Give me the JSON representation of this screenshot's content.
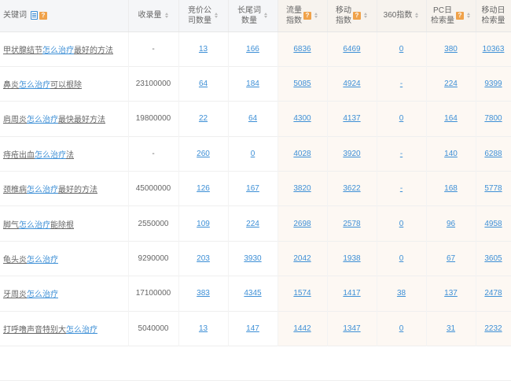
{
  "columns": {
    "keyword": "关键词",
    "indexed": "收录量",
    "bid_line1": "竞价公",
    "bid_line2": "司数量",
    "longtail_line1": "长尾词",
    "longtail_line2": "数量",
    "traffic_line1": "流量",
    "traffic_line2": "指数",
    "mobile_line1": "移动",
    "mobile_line2": "指数",
    "idx360": "360指数",
    "pc_line1": "PC日",
    "pc_line2": "检索量",
    "mob_line1": "移动日",
    "mob_line2": "检索量",
    "help_glyph": "?"
  },
  "rows": [
    {
      "pre": "甲状腺结节",
      "hl": "怎么治疗",
      "post": "最好的方法",
      "indexed": "-",
      "bid": "13",
      "longtail": "166",
      "traffic": "6836",
      "mobile": "6469",
      "idx360": "0",
      "pc": "380",
      "mob": "10363"
    },
    {
      "pre": "鼻炎",
      "hl": "怎么治疗",
      "post": "可以根除",
      "indexed": "23100000",
      "bid": "64",
      "longtail": "184",
      "traffic": "5085",
      "mobile": "4924",
      "idx360": "-",
      "pc": "224",
      "mob": "9399"
    },
    {
      "pre": "肩周炎",
      "hl": "怎么治疗",
      "post": "最快最好方法",
      "indexed": "19800000",
      "bid": "22",
      "longtail": "64",
      "traffic": "4300",
      "mobile": "4137",
      "idx360": "0",
      "pc": "164",
      "mob": "7800"
    },
    {
      "pre": "痔疮出血",
      "hl": "怎么治疗",
      "post": "法",
      "indexed": "-",
      "bid": "260",
      "longtail": "0",
      "traffic": "4028",
      "mobile": "3920",
      "idx360": "-",
      "pc": "140",
      "mob": "6288"
    },
    {
      "pre": "颈椎病",
      "hl": "怎么治疗",
      "post": "最好的方法",
      "indexed": "45000000",
      "bid": "126",
      "longtail": "167",
      "traffic": "3820",
      "mobile": "3622",
      "idx360": "-",
      "pc": "168",
      "mob": "5778"
    },
    {
      "pre": "脚气",
      "hl": "怎么治疗",
      "post": "能除根",
      "indexed": "2550000",
      "bid": "109",
      "longtail": "224",
      "traffic": "2698",
      "mobile": "2578",
      "idx360": "0",
      "pc": "96",
      "mob": "4958"
    },
    {
      "pre": "龟头炎",
      "hl": "怎么治疗",
      "post": "",
      "indexed": "9290000",
      "bid": "203",
      "longtail": "3930",
      "traffic": "2042",
      "mobile": "1938",
      "idx360": "0",
      "pc": "67",
      "mob": "3605"
    },
    {
      "pre": "牙周炎",
      "hl": "怎么治疗",
      "post": "",
      "indexed": "17100000",
      "bid": "383",
      "longtail": "4345",
      "traffic": "1574",
      "mobile": "1417",
      "idx360": "38",
      "pc": "137",
      "mob": "2478"
    },
    {
      "pre": "打呼噜声音特别大",
      "hl": "怎么治疗",
      "post": "",
      "indexed": "5040000",
      "bid": "13",
      "longtail": "147",
      "traffic": "1442",
      "mobile": "1347",
      "idx360": "0",
      "pc": "31",
      "mob": "2232"
    }
  ]
}
